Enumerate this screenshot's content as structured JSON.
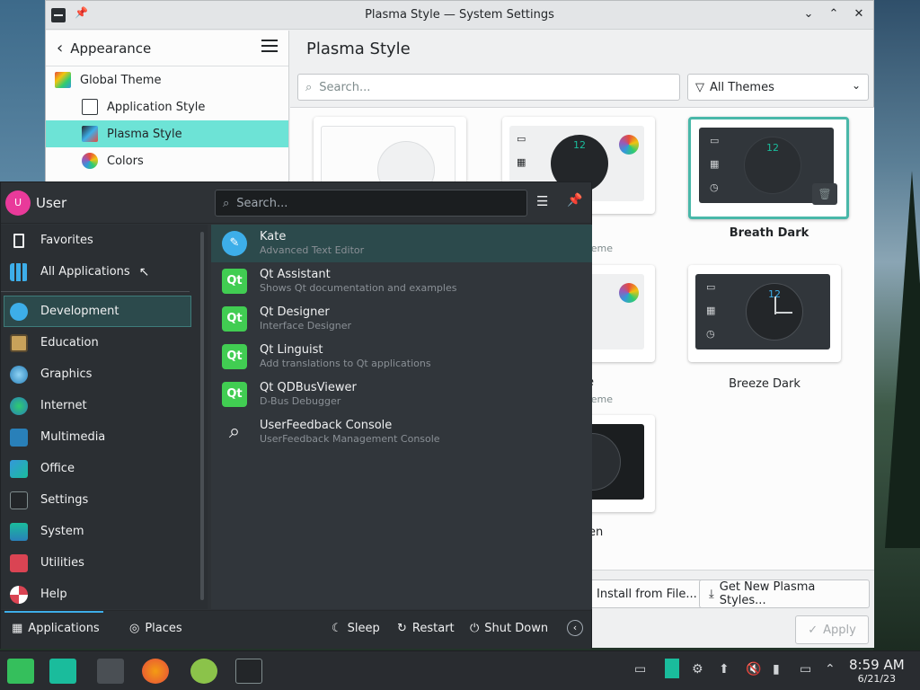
{
  "window": {
    "title": "Plasma Style — System Settings",
    "btn_min": "⌄",
    "btn_max": "⌃",
    "btn_close": "✕"
  },
  "sidebar": {
    "back_label": "Appearance",
    "items": [
      {
        "label": "Global Theme"
      },
      {
        "label": "Application Style"
      },
      {
        "label": "Plasma Style"
      },
      {
        "label": "Colors"
      }
    ]
  },
  "content": {
    "title": "Plasma Style",
    "search_placeholder": "Search...",
    "filter_value": "All Themes",
    "themes": [
      {
        "label": "",
        "sub": ""
      },
      {
        "label": "h",
        "sub": "scheme"
      },
      {
        "label": "Breath Dark",
        "sub": ""
      },
      {
        "label": "e",
        "sub": "scheme"
      },
      {
        "label": "Breeze Dark",
        "sub": ""
      },
      {
        "label": "en",
        "sub": ""
      }
    ],
    "install_button": "Install from File...",
    "get_new_button": "Get New Plasma Styles...",
    "apply_button": "Apply"
  },
  "launcher": {
    "avatar_letter": "U",
    "user": "User",
    "search_placeholder": "Search...",
    "categories": [
      {
        "label": "Favorites"
      },
      {
        "label": "All Applications"
      },
      {
        "label": "Development"
      },
      {
        "label": "Education"
      },
      {
        "label": "Graphics"
      },
      {
        "label": "Internet"
      },
      {
        "label": "Multimedia"
      },
      {
        "label": "Office"
      },
      {
        "label": "Settings"
      },
      {
        "label": "System"
      },
      {
        "label": "Utilities"
      },
      {
        "label": "Help"
      }
    ],
    "apps": [
      {
        "name": "Kate",
        "desc": "Advanced Text Editor"
      },
      {
        "name": "Qt Assistant",
        "desc": "Shows Qt documentation and examples"
      },
      {
        "name": "Qt Designer",
        "desc": "Interface Designer"
      },
      {
        "name": "Qt Linguist",
        "desc": "Add translations to Qt applications"
      },
      {
        "name": "Qt QDBusViewer",
        "desc": "D-Bus Debugger"
      },
      {
        "name": "UserFeedback Console",
        "desc": "UserFeedback Management Console"
      }
    ],
    "footer": {
      "applications": "Applications",
      "places": "Places",
      "sleep": "Sleep",
      "restart": "Restart",
      "shutdown": "Shut Down"
    }
  },
  "taskbar": {
    "time": "8:59 AM",
    "date": "6/21/23"
  },
  "colors": {
    "accent": "#3daee9",
    "selection_light": "#6de3d6",
    "selection_dark": "#2c4a4c"
  }
}
